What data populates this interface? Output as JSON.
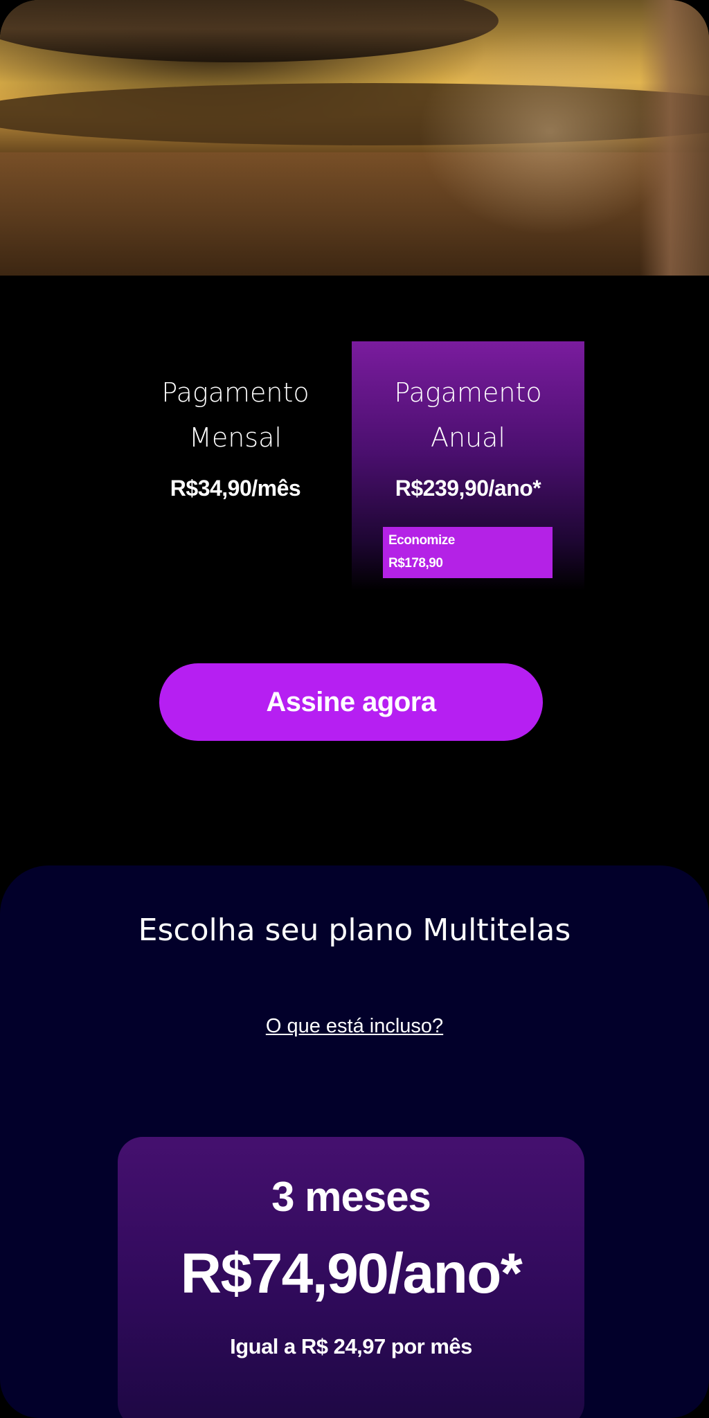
{
  "plans": {
    "monthly": {
      "title_line1": "Pagamento",
      "title_line2": "Mensal",
      "price": "R$34,90/mês"
    },
    "annual": {
      "title_line1": "Pagamento",
      "title_line2": "Anual",
      "price": "R$239,90/ano*",
      "badge_line1": "Economize",
      "badge_line2": "R$178,90"
    },
    "cta_label": "Assine agora"
  },
  "multitelas": {
    "title": "Escolha seu plano Multitelas",
    "link": "O que está incluso?",
    "card": {
      "period": "3 meses",
      "price": "R$74,90/ano*",
      "note": "Igual a R$ 24,97 por mês"
    }
  },
  "colors": {
    "accent": "#b61ff2",
    "badge": "#b422e6",
    "section_bg": "#02002a"
  }
}
